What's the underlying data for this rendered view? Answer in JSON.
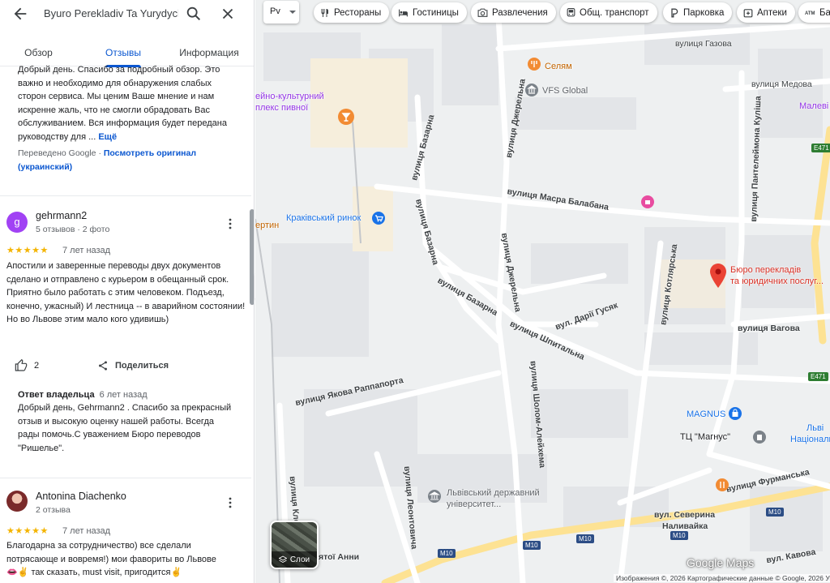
{
  "search": {
    "query": "Byuro Perekladiv Ta Yurydych"
  },
  "tabs": [
    {
      "label": "Обзор"
    },
    {
      "label": "Отзывы"
    },
    {
      "label": "Информация"
    }
  ],
  "reviews": [
    {
      "text": "Добрый день. Спасибо за подробный обзор. Это важно и необходимо для обнаружения слабых сторон сервиса. Мы ценим Ваше мнение и нам искренне жаль, что не смогли обрадовать Вас обслуживанием. Вся информация будет передана руководству для ...",
      "more": "Ещё",
      "translated_note": "Переведено Google",
      "sep": "·",
      "show_original": "Посмотреть оригинал (украинский)"
    },
    {
      "avatar_letter": "g",
      "avatar_color": "#a142f4",
      "author": "gehrmann2",
      "meta": "5 отзывов · 2 фото",
      "stars": "★★★★★",
      "rating": 5,
      "time": "7 лет назад",
      "text": "Апостили и заверенные переводы двух документов сделано и отправлено с курьером в обещанный срок. Приятно было работать с этим человеком. Подъезд, конечно, ужасный) И лестница -- в аварийном состоянии! Но во Львове этим мало кого удивишь)",
      "likes": "2",
      "share": "Поделиться",
      "owner_reply": {
        "label": "Ответ владельца",
        "time": "6 лет назад",
        "text": "Добрый день, Gehrmann2 . Спасибо за прекрасный отзыв и высокую оценку нашей работы. Всегда рады помочь.С уважением Бюро переводов \"Ришелье\"."
      }
    },
    {
      "author": "Antonina Diachenko",
      "meta": "2 отзыва",
      "stars": "★★★★★",
      "rating": 5,
      "time": "7 лет назад",
      "text_line1": "Благодарна за сотрудничество) все сделали",
      "text_line2": "потрясающе и вовремя!) мои фавориты во Львове",
      "text_line3_emoji": "👄✌️",
      "text_line3": " так сказать, must visit, пригодится",
      "text_line3_end": "✌️"
    }
  ],
  "map": {
    "lang": "Рv",
    "chips": [
      {
        "icon": "fork-knife-icon",
        "label": "Рестораны"
      },
      {
        "icon": "bed-icon",
        "label": "Гостиницы"
      },
      {
        "icon": "camera-icon",
        "label": "Развлечения"
      },
      {
        "icon": "bus-icon",
        "label": "Общ. транспорт"
      },
      {
        "icon": "parking-icon",
        "label": "Парковка"
      },
      {
        "icon": "medicine-icon",
        "label": "Аптеки"
      },
      {
        "icon": "atm-icon",
        "label": "Ба"
      }
    ],
    "streets": {
      "gazova": "вулиця Газова",
      "medova": "вулиця Медова",
      "masra": "вулиця Масра Балабана",
      "bazarna1": "вулиця Базарна",
      "bazarna2": "вулиця Базарна",
      "bazarna3": "вулиця Базарна",
      "dzherelna1": "вулиця Джерельна",
      "dzherelna2": "вулиця Джерельна",
      "kulish": "вулиця Пантелеймона Куліша",
      "kotlyarska": "вулиця Котлярська",
      "darii": "вул. Дарії Гусяк",
      "shpytalna": "вулиця Шпитальна",
      "vagova": "вулиця Вагова",
      "rappaport": "вулиця Якова Раппапорта",
      "sholom": "вулиця Шолом-Алейхема",
      "furmanska": "вулиця Фурманська",
      "naluvayka1": "вул. Северина",
      "naluvayka2": "Наливайка",
      "leontovycha": "вулиця Леонтовича",
      "klepar": "вулиця Клепар",
      "anny": "ятої Анни",
      "kavova": "вул. Кавова"
    },
    "pois": {
      "selyam": "Селям",
      "vfs": "VFS Global",
      "cultural1": "ейно-культурний",
      "cultural2": "плекс пивної",
      "market": "Краківський ринок",
      "bertin": "ертин",
      "bureau1": "Бюро перекладів",
      "bureau2": "та юридичних послуг...",
      "magnus": "MAGNUS",
      "tc_magnus": "ТЦ \"Магнус\"",
      "university1": "Львівський державний",
      "university2": "університет...",
      "national1": "Льві",
      "national2": "Національна С",
      "malevi": "Малеві"
    },
    "roads": {
      "e471a": "E471",
      "e471b": "E471",
      "m10a": "M10",
      "m10b": "M10",
      "m10c": "M10",
      "m10d": "M10",
      "m10e": "M10"
    },
    "layers_label": "Слои",
    "logo": "Google Maps",
    "footer": "Изображения ©, 2026 Картографические данные © Google, 2026   Украина   Условия   Конфиденциальность   Отправить отзыв о продукте   20 м"
  }
}
